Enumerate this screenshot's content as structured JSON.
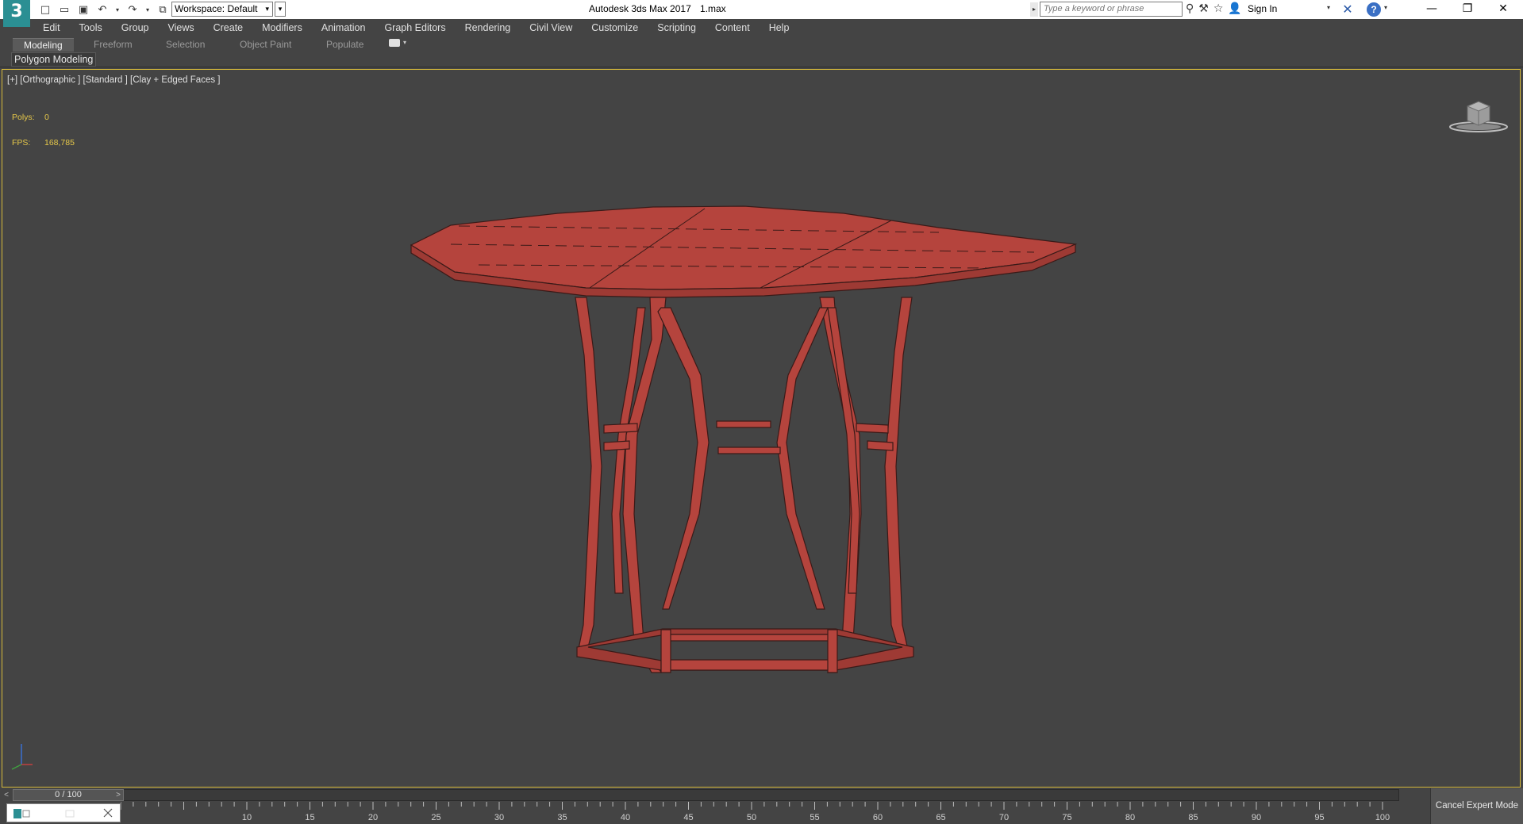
{
  "titlebar": {
    "logo": "3",
    "workspace": "Workspace: Default",
    "app_title": "Autodesk 3ds Max 2017",
    "file_name": "1.max",
    "search_placeholder": "Type a keyword or phrase",
    "sign_in": "Sign In"
  },
  "menu": [
    "Edit",
    "Tools",
    "Group",
    "Views",
    "Create",
    "Modifiers",
    "Animation",
    "Graph Editors",
    "Rendering",
    "Civil View",
    "Customize",
    "Scripting",
    "Content",
    "Help"
  ],
  "ribbon": {
    "tabs": [
      "Modeling",
      "Freeform",
      "Selection",
      "Object Paint",
      "Populate"
    ],
    "active_tab": "Modeling",
    "panel_label": "Polygon Modeling"
  },
  "viewport": {
    "label": "[+] [Orthographic ] [Standard ] [Clay + Edged Faces ]",
    "polys_label": "Polys:",
    "polys_value": "0",
    "fps_label": "FPS:",
    "fps_value": "168,785",
    "border_color": "#d6b93a",
    "model_color": "#b5443d"
  },
  "timeline": {
    "frame_display": "0 / 100",
    "ticks": [
      "10",
      "15",
      "20",
      "25",
      "30",
      "35",
      "40",
      "45",
      "50",
      "55",
      "60",
      "65",
      "70",
      "75",
      "80",
      "85",
      "90",
      "95",
      "100"
    ]
  },
  "status": {
    "cancel_expert": "Cancel Expert Mode"
  }
}
